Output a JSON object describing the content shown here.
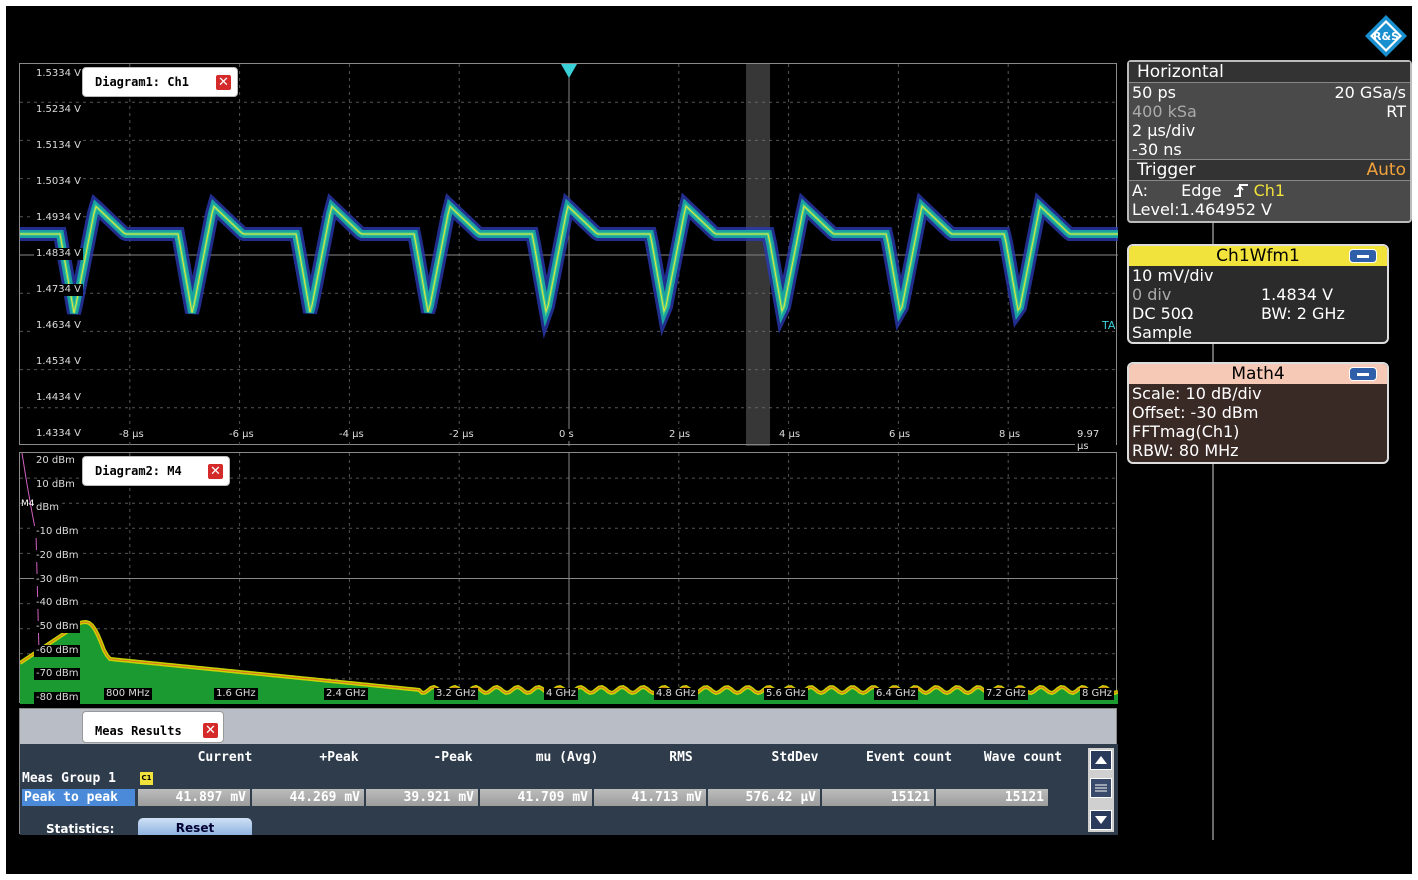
{
  "brand": {
    "logo_text": "R&S"
  },
  "diagram1": {
    "tab_label": "Diagram1: Ch1",
    "close_glyph": "✕",
    "y_ticks": [
      "1.5334 V",
      "1.5234 V",
      "1.5134 V",
      "1.5034 V",
      "1.4934 V",
      "1.4834 V",
      "1.4734 V",
      "1.4634 V",
      "1.4534 V",
      "1.4434 V",
      "1.4334 V"
    ],
    "x_ticks": [
      "-8 µs",
      "-6 µs",
      "-4 µs",
      "-2 µs",
      "0 s",
      "2 µs",
      "4 µs",
      "6 µs",
      "8 µs",
      "9.97 µs"
    ],
    "trigger_marker_label": "TA",
    "waveform_color": "#3fd08a",
    "envelope_color": "#2a3ab0"
  },
  "diagram2": {
    "tab_label": "Diagram2: M4",
    "close_glyph": "✕",
    "y_ticks": [
      "20 dBm",
      "10 dBm",
      "dBm",
      "-10 dBm",
      "-20 dBm",
      "-30 dBm",
      "-40 dBm",
      "-50 dBm",
      "-60 dBm",
      "-70 dBm",
      "-80 dBm"
    ],
    "x_ticks": [
      "800 MHz",
      "1.6 GHz",
      "2.4 GHz",
      "3.2 GHz",
      "4 GHz",
      "4.8 GHz",
      "5.6 GHz",
      "6.4 GHz",
      "7.2 GHz",
      "8 GHz"
    ],
    "marker_label": "M4",
    "spectrum_color": "#c8d400"
  },
  "horizontal": {
    "title": "Horizontal",
    "res": "50 ps",
    "rate": "20 GSa/s",
    "rec": "400 kSa",
    "mode": "RT",
    "timebase": "2 µs/div",
    "offset": "-30 ns"
  },
  "trigger": {
    "title": "Trigger",
    "mode": "Auto",
    "source_prefix": "A:",
    "type": "Edge",
    "source": "Ch1",
    "level_label": "Level:",
    "level": "1.464952 V"
  },
  "ch1wfm": {
    "title": "Ch1Wfm1",
    "scale": "10 mV/div",
    "div": "0 div",
    "offset": "1.4834 V",
    "coupling": "DC 50Ω",
    "bw": "BW: 2 GHz",
    "acq": "Sample"
  },
  "math4": {
    "title": "Math4",
    "scale": "Scale:  10 dB/div",
    "offset": "Offset: -30 dBm",
    "func": "FFTmag(Ch1)",
    "rbw": "RBW:   80 MHz"
  },
  "meas": {
    "tab_label": "Meas Results",
    "close_glyph": "✕",
    "headers": [
      "Current",
      "+Peak",
      "-Peak",
      "mu (Avg)",
      "RMS",
      "StdDev",
      "Event count",
      "Wave count"
    ],
    "group_label": "Meas Group 1",
    "group_badge": "C1",
    "row_label": "Peak to peak",
    "values": [
      "41.897 mV",
      "44.269 mV",
      "39.921 mV",
      "41.709 mV",
      "41.713 mV",
      "576.42 µV",
      "15121",
      "15121"
    ],
    "stats_label": "Statistics:",
    "reset_label": "Reset"
  }
}
